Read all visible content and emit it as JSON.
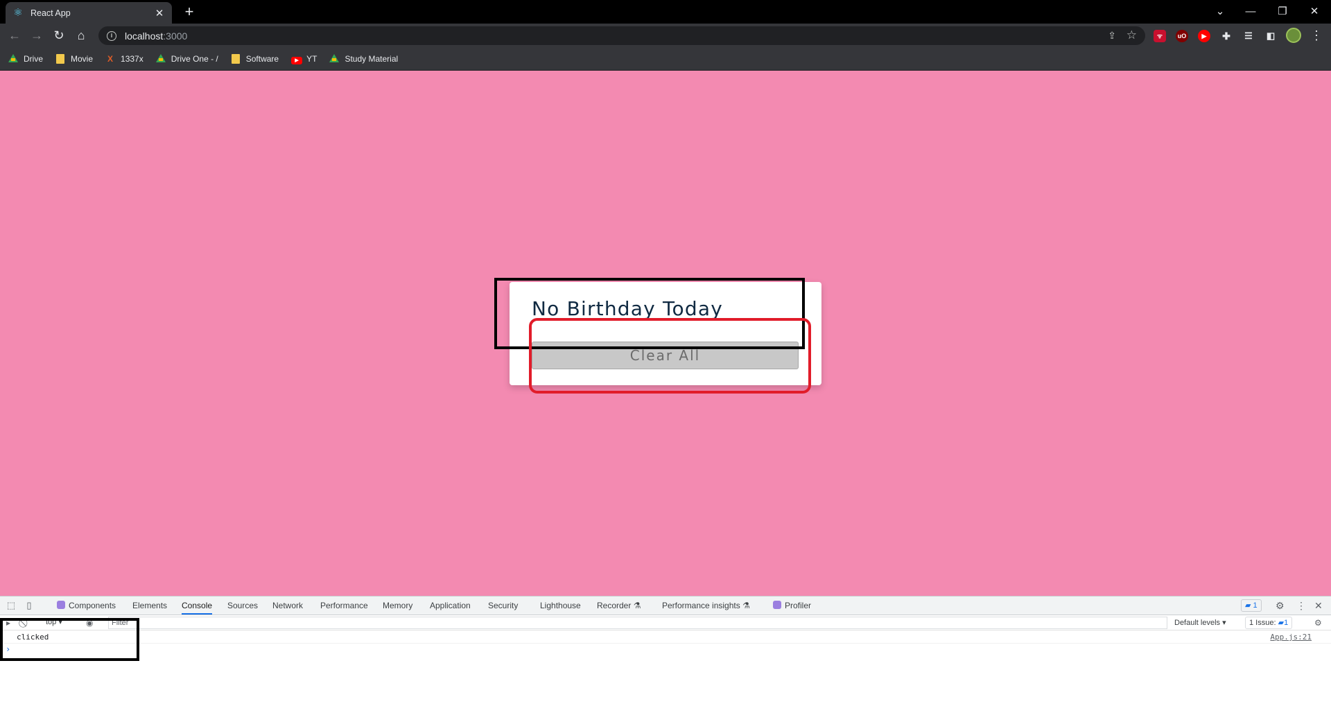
{
  "browser": {
    "tab_title": "React App",
    "tab_close": "✕",
    "new_tab": "+",
    "url_host": "localhost",
    "url_port": ":3000",
    "window_controls": {
      "chevron": "⌄",
      "minimize": "—",
      "restore": "❐",
      "close": "✕"
    }
  },
  "bookmarks": [
    {
      "label": "Drive",
      "icon": "drive-icon"
    },
    {
      "label": "Movie",
      "icon": "folder-icon"
    },
    {
      "label": "1337x",
      "icon": "x-icon"
    },
    {
      "label": "Drive One - /",
      "icon": "drive-icon"
    },
    {
      "label": "Software",
      "icon": "folder-icon"
    },
    {
      "label": "YT",
      "icon": "youtube-icon"
    },
    {
      "label": "Study Material",
      "icon": "drive-icon"
    }
  ],
  "page": {
    "background": "#f38ab1",
    "title": "No Birthday Today",
    "clear_button": "Clear All"
  },
  "devtools": {
    "tabs": [
      "Components",
      "Elements",
      "Console",
      "Sources",
      "Network",
      "Performance",
      "Memory",
      "Application",
      "Security",
      "Lighthouse",
      "Recorder",
      "Performance insights",
      "Profiler"
    ],
    "active_tab": "Console",
    "message_badge": "1",
    "context": "top",
    "filter_placeholder": "Filter",
    "levels": "Default levels",
    "issues_label": "1 Issue:",
    "issues_count": "1",
    "log": {
      "message": "clicked",
      "source": "App.js:21"
    },
    "prompt": "›"
  }
}
